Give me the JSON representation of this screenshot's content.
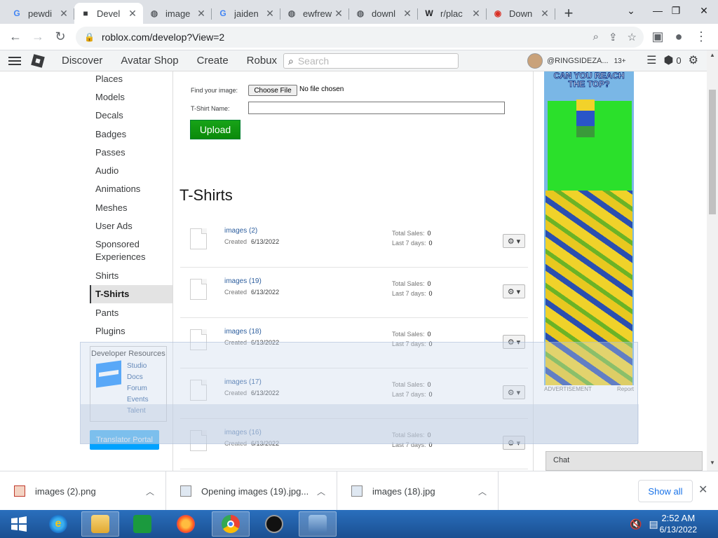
{
  "browser": {
    "tabs": [
      {
        "label": "pewdi",
        "icon": "google-icon",
        "glyph": "G",
        "color": "#4285f4"
      },
      {
        "label": "Devel",
        "icon": "roblox-icon",
        "glyph": "■",
        "color": "#393b3d",
        "active": true
      },
      {
        "label": "image",
        "icon": "globe-icon",
        "glyph": "◍",
        "color": "#5f6368"
      },
      {
        "label": "jaiden",
        "icon": "google-icon",
        "glyph": "G",
        "color": "#4285f4"
      },
      {
        "label": "ewfrew",
        "icon": "globe-icon",
        "glyph": "◍",
        "color": "#5f6368"
      },
      {
        "label": "downl",
        "icon": "globe-icon",
        "glyph": "◍",
        "color": "#5f6368"
      },
      {
        "label": "r/plac",
        "icon": "wikipedia-icon",
        "glyph": "W",
        "color": "#202124"
      },
      {
        "label": "Down",
        "icon": "download-site-icon",
        "glyph": "◉",
        "color": "#d93025"
      }
    ],
    "new_tab": "+",
    "url": "roblox.com/develop?View=2"
  },
  "roblox_header": {
    "nav": [
      "Discover",
      "Avatar Shop",
      "Create",
      "Robux"
    ],
    "search_placeholder": "Search",
    "username": "@RINGSIDEZA...",
    "age": "13+",
    "robux": "0"
  },
  "sidebar": {
    "items": [
      "Places",
      "Models",
      "Decals",
      "Badges",
      "Passes",
      "Audio",
      "Animations",
      "Meshes",
      "User Ads",
      "Sponsored Experiences",
      "Shirts",
      "T-Shirts",
      "Pants",
      "Plugins"
    ],
    "active": "T-Shirts",
    "dev_resources": {
      "title": "Developer Resources",
      "links": [
        "Studio",
        "Docs",
        "Forum",
        "Events",
        "Talent"
      ]
    },
    "translator_portal": "Translator Portal"
  },
  "upload_form": {
    "find_label": "Find your image:",
    "choose_file": "Choose File",
    "no_file": "No file chosen",
    "name_label": "T-Shirt Name:",
    "name_value": "",
    "upload_button": "Upload"
  },
  "tshirts": {
    "heading": "T-Shirts",
    "created_label": "Created",
    "total_sales_label": "Total Sales:",
    "last7_label": "Last 7 days:",
    "items": [
      {
        "name": "images (2)",
        "created": "6/13/2022",
        "total_sales": "0",
        "last7": "0"
      },
      {
        "name": "images (19)",
        "created": "6/13/2022",
        "total_sales": "0",
        "last7": "0"
      },
      {
        "name": "images (18)",
        "created": "6/13/2022",
        "total_sales": "0",
        "last7": "0"
      },
      {
        "name": "images (17)",
        "created": "6/13/2022",
        "total_sales": "0",
        "last7": "0"
      },
      {
        "name": "images (16)",
        "created": "6/13/2022",
        "total_sales": "0",
        "last7": "0"
      }
    ]
  },
  "ad": {
    "headline": "CAN YOU REACH THE TOP?",
    "label": "ADVERTISEMENT",
    "report": "Report"
  },
  "chat": {
    "label": "Chat"
  },
  "downloads": {
    "items": [
      {
        "name": "images (2).png"
      },
      {
        "name": "Opening images (19).jpg..."
      },
      {
        "name": "images (18).jpg"
      }
    ],
    "show_all": "Show all"
  },
  "taskbar": {
    "time": "2:52 AM",
    "date": "6/13/2022"
  }
}
